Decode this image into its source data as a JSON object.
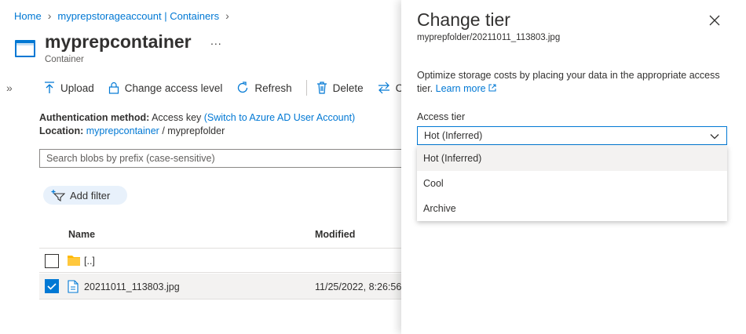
{
  "breadcrumb": {
    "home": "Home",
    "account": "myprepstorageaccount | Containers"
  },
  "header": {
    "title": "myprepcontainer",
    "more": "...",
    "subtitle": "Container",
    "collapse": "»"
  },
  "toolbar": {
    "upload": "Upload",
    "change_access": "Change access level",
    "refresh": "Refresh",
    "delete": "Delete",
    "truncated": "Ch"
  },
  "auth": {
    "label": "Authentication method:",
    "value": "Access key",
    "switch_link": "(Switch to Azure AD User Account)"
  },
  "location": {
    "label": "Location:",
    "container": "myprepcontainer",
    "sep": "/",
    "folder": "myprepfolder"
  },
  "search": {
    "placeholder": "Search blobs by prefix (case-sensitive)"
  },
  "filter": {
    "label": "Add filter"
  },
  "table": {
    "columns": {
      "name": "Name",
      "modified": "Modified"
    },
    "rows": [
      {
        "name": "[..]",
        "modified": "",
        "checked": false,
        "icon": "folder-icon"
      },
      {
        "name": "20211011_113803.jpg",
        "modified": "11/25/2022, 8:26:56",
        "checked": true,
        "icon": "file-icon"
      }
    ]
  },
  "panel": {
    "title": "Change tier",
    "subtitle": "myprepfolder/20211011_113803.jpg",
    "description": "Optimize storage costs by placing your data in the appropriate access tier.",
    "learn_more": "Learn more",
    "tier_label": "Access tier",
    "selected": "Hot (Inferred)",
    "options": [
      "Hot (Inferred)",
      "Cool",
      "Archive"
    ]
  },
  "colors": {
    "accent": "#0078d4",
    "text": "#323130",
    "folder": "#ffb900"
  }
}
